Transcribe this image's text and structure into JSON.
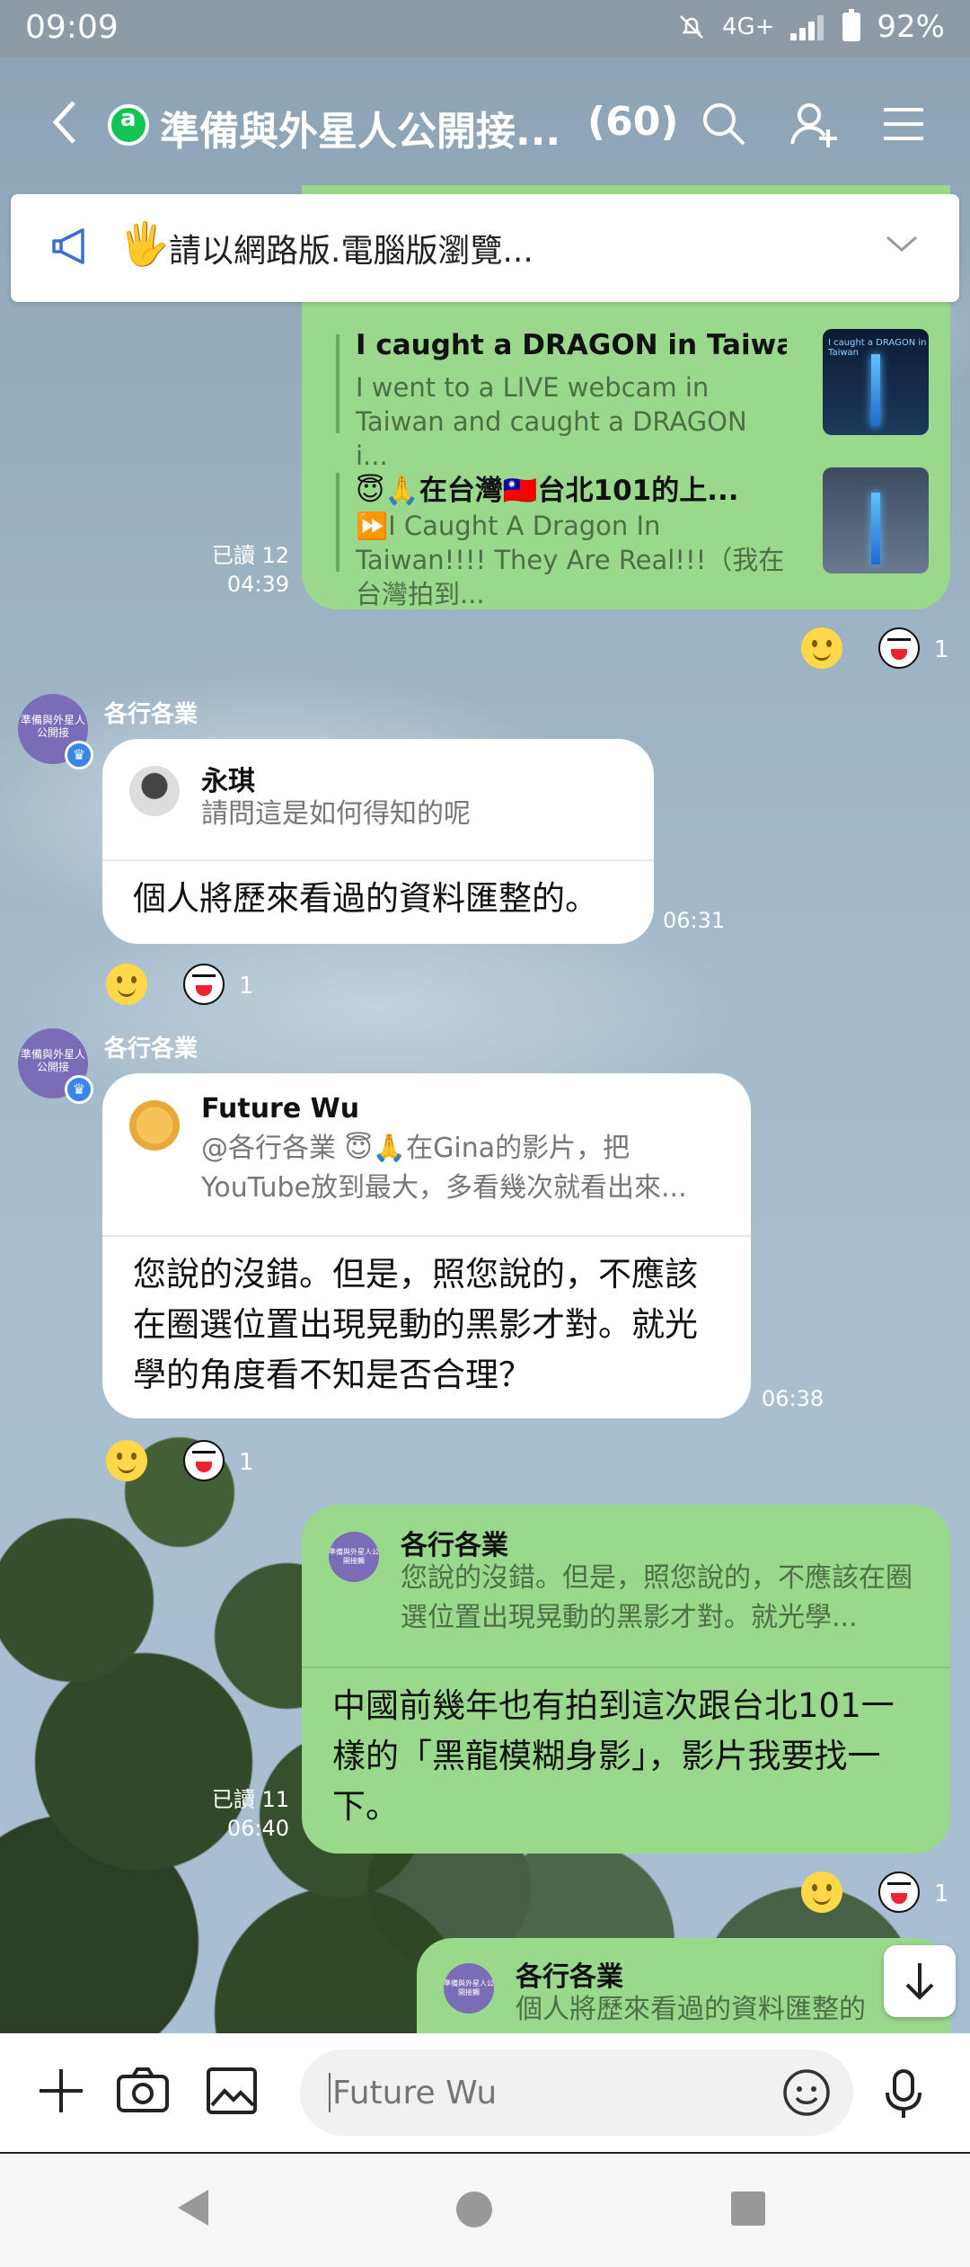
{
  "status_bar": {
    "time": "09:09",
    "network": "4G+",
    "battery": "92%"
  },
  "header": {
    "title": "準備與外星人公開接...",
    "member_count": "(60)"
  },
  "announcement": {
    "text": "請以網路版.電腦版瀏覽..."
  },
  "messages": {
    "m1": {
      "links": [
        {
          "title": "I caught a DRAGON in Taiwan...",
          "desc": "I went to a LIVE webcam in Taiwan and caught a DRAGON i...",
          "thumb_label": "I caught a DRAGON in Taiwan"
        },
        {
          "title": "😇🙏在台灣🇹🇼台北101的上...",
          "desc": "⏩I Caught A Dragon In Taiwan!!!! They Are Real!!!（我在台灣拍到..."
        }
      ],
      "read": "已讀 12",
      "time": "04:39",
      "reaction_count": "1"
    },
    "m2": {
      "sender": "各行各業",
      "avatar_text": "準備與外星人公開接",
      "quote_name": "永琪",
      "quote_text": "請問這是如何得知的呢",
      "text": "個人將歷來看過的資料匯整的。",
      "time": "06:31",
      "reaction_count": "1"
    },
    "m3": {
      "sender": "各行各業",
      "avatar_text": "準備與外星人公開接",
      "quote_name": "Future Wu",
      "quote_text": "@各行各業 😇🙏在Gina的影片，把YouTube放到最大，多看幾次就看出來...",
      "text": "您說的沒錯。但是，照您說的，不應該在圈選位置出現晃動的黑影才對。就光學的角度看不知是否合理？",
      "time": "06:38",
      "reaction_count": "1"
    },
    "m4": {
      "quote_name": "各行各業",
      "quote_avatar_text": "準備與外星人公開接觸",
      "quote_text": "您說的沒錯。但是，照您說的，不應該在圈選位置出現晃動的黑影才對。就光學...",
      "text": "中國前幾年也有拍到這次跟台北101一樣的「黑龍模糊身影」，影片我要找一下。",
      "read": "已讀 11",
      "time": "06:40",
      "reaction_count": "1"
    },
    "m5": {
      "quote_name": "各行各業",
      "quote_avatar_text": "準備與外星人公開接觸",
      "quote_text": "個人將歷來看過的資料匯整的"
    }
  },
  "input": {
    "placeholder": "Future Wu"
  }
}
